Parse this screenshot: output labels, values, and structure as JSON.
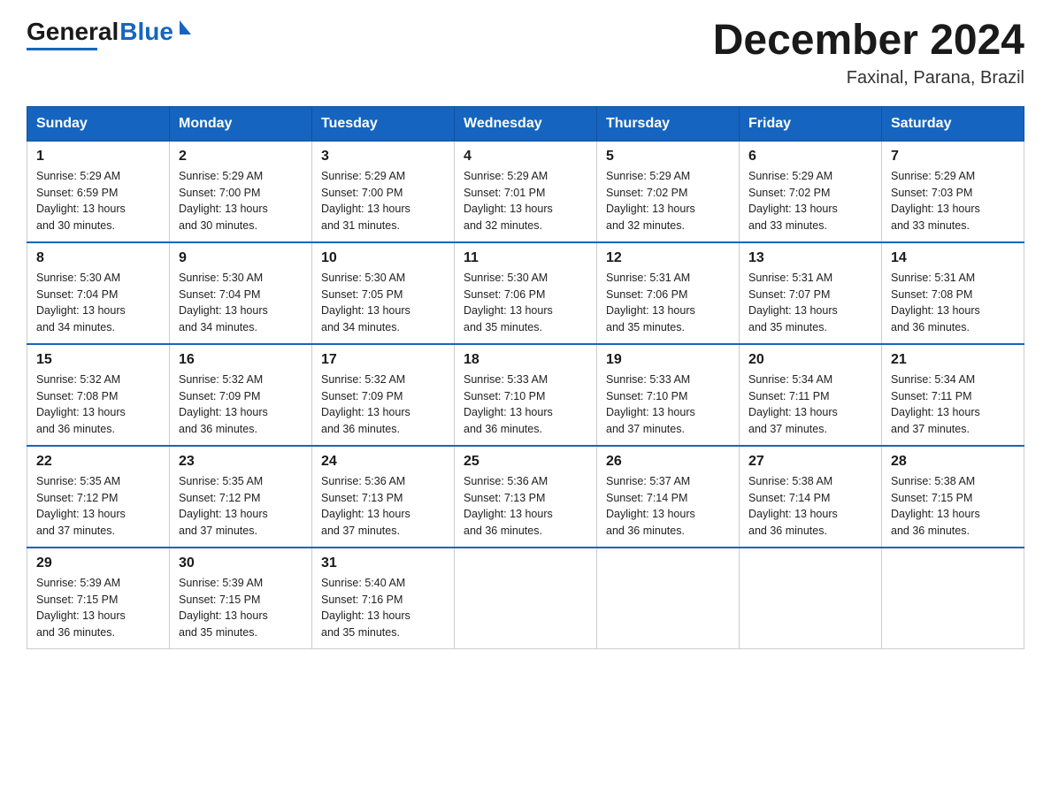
{
  "header": {
    "logo_general": "General",
    "logo_blue": "Blue",
    "title": "December 2024",
    "subtitle": "Faxinal, Parana, Brazil"
  },
  "columns": [
    "Sunday",
    "Monday",
    "Tuesday",
    "Wednesday",
    "Thursday",
    "Friday",
    "Saturday"
  ],
  "weeks": [
    [
      {
        "day": "1",
        "sunrise": "5:29 AM",
        "sunset": "6:59 PM",
        "daylight": "13 hours and 30 minutes."
      },
      {
        "day": "2",
        "sunrise": "5:29 AM",
        "sunset": "7:00 PM",
        "daylight": "13 hours and 30 minutes."
      },
      {
        "day": "3",
        "sunrise": "5:29 AM",
        "sunset": "7:00 PM",
        "daylight": "13 hours and 31 minutes."
      },
      {
        "day": "4",
        "sunrise": "5:29 AM",
        "sunset": "7:01 PM",
        "daylight": "13 hours and 32 minutes."
      },
      {
        "day": "5",
        "sunrise": "5:29 AM",
        "sunset": "7:02 PM",
        "daylight": "13 hours and 32 minutes."
      },
      {
        "day": "6",
        "sunrise": "5:29 AM",
        "sunset": "7:02 PM",
        "daylight": "13 hours and 33 minutes."
      },
      {
        "day": "7",
        "sunrise": "5:29 AM",
        "sunset": "7:03 PM",
        "daylight": "13 hours and 33 minutes."
      }
    ],
    [
      {
        "day": "8",
        "sunrise": "5:30 AM",
        "sunset": "7:04 PM",
        "daylight": "13 hours and 34 minutes."
      },
      {
        "day": "9",
        "sunrise": "5:30 AM",
        "sunset": "7:04 PM",
        "daylight": "13 hours and 34 minutes."
      },
      {
        "day": "10",
        "sunrise": "5:30 AM",
        "sunset": "7:05 PM",
        "daylight": "13 hours and 34 minutes."
      },
      {
        "day": "11",
        "sunrise": "5:30 AM",
        "sunset": "7:06 PM",
        "daylight": "13 hours and 35 minutes."
      },
      {
        "day": "12",
        "sunrise": "5:31 AM",
        "sunset": "7:06 PM",
        "daylight": "13 hours and 35 minutes."
      },
      {
        "day": "13",
        "sunrise": "5:31 AM",
        "sunset": "7:07 PM",
        "daylight": "13 hours and 35 minutes."
      },
      {
        "day": "14",
        "sunrise": "5:31 AM",
        "sunset": "7:08 PM",
        "daylight": "13 hours and 36 minutes."
      }
    ],
    [
      {
        "day": "15",
        "sunrise": "5:32 AM",
        "sunset": "7:08 PM",
        "daylight": "13 hours and 36 minutes."
      },
      {
        "day": "16",
        "sunrise": "5:32 AM",
        "sunset": "7:09 PM",
        "daylight": "13 hours and 36 minutes."
      },
      {
        "day": "17",
        "sunrise": "5:32 AM",
        "sunset": "7:09 PM",
        "daylight": "13 hours and 36 minutes."
      },
      {
        "day": "18",
        "sunrise": "5:33 AM",
        "sunset": "7:10 PM",
        "daylight": "13 hours and 36 minutes."
      },
      {
        "day": "19",
        "sunrise": "5:33 AM",
        "sunset": "7:10 PM",
        "daylight": "13 hours and 37 minutes."
      },
      {
        "day": "20",
        "sunrise": "5:34 AM",
        "sunset": "7:11 PM",
        "daylight": "13 hours and 37 minutes."
      },
      {
        "day": "21",
        "sunrise": "5:34 AM",
        "sunset": "7:11 PM",
        "daylight": "13 hours and 37 minutes."
      }
    ],
    [
      {
        "day": "22",
        "sunrise": "5:35 AM",
        "sunset": "7:12 PM",
        "daylight": "13 hours and 37 minutes."
      },
      {
        "day": "23",
        "sunrise": "5:35 AM",
        "sunset": "7:12 PM",
        "daylight": "13 hours and 37 minutes."
      },
      {
        "day": "24",
        "sunrise": "5:36 AM",
        "sunset": "7:13 PM",
        "daylight": "13 hours and 37 minutes."
      },
      {
        "day": "25",
        "sunrise": "5:36 AM",
        "sunset": "7:13 PM",
        "daylight": "13 hours and 36 minutes."
      },
      {
        "day": "26",
        "sunrise": "5:37 AM",
        "sunset": "7:14 PM",
        "daylight": "13 hours and 36 minutes."
      },
      {
        "day": "27",
        "sunrise": "5:38 AM",
        "sunset": "7:14 PM",
        "daylight": "13 hours and 36 minutes."
      },
      {
        "day": "28",
        "sunrise": "5:38 AM",
        "sunset": "7:15 PM",
        "daylight": "13 hours and 36 minutes."
      }
    ],
    [
      {
        "day": "29",
        "sunrise": "5:39 AM",
        "sunset": "7:15 PM",
        "daylight": "13 hours and 36 minutes."
      },
      {
        "day": "30",
        "sunrise": "5:39 AM",
        "sunset": "7:15 PM",
        "daylight": "13 hours and 35 minutes."
      },
      {
        "day": "31",
        "sunrise": "5:40 AM",
        "sunset": "7:16 PM",
        "daylight": "13 hours and 35 minutes."
      },
      null,
      null,
      null,
      null
    ]
  ],
  "labels": {
    "sunrise": "Sunrise:",
    "sunset": "Sunset:",
    "daylight": "Daylight:"
  }
}
